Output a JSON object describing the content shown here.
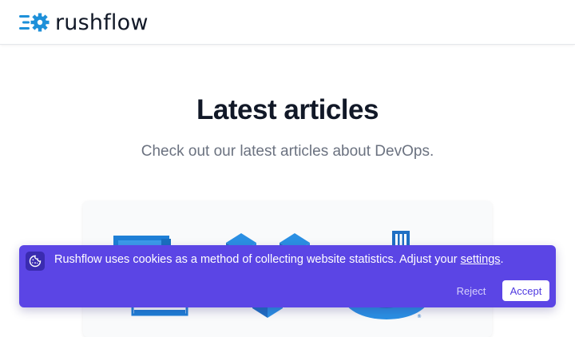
{
  "header": {
    "brand_name": "rushflow",
    "logo_icon": "gear-speed-icon"
  },
  "hero": {
    "title": "Latest articles",
    "subtitle": "Check out our latest articles about DevOps."
  },
  "article_card": {
    "illustration_icons": [
      "monitor-icon",
      "cube-icon",
      "sql-server-icon"
    ]
  },
  "cookie_banner": {
    "icon": "cookie-icon",
    "message": "Rushflow uses cookies as a method of collecting website statistics. Adjust your ",
    "link_label": "settings",
    "message_end": ".",
    "reject_label": "Reject",
    "accept_label": "Accept"
  },
  "colors": {
    "brand": "#1e90d9",
    "banner": "#5b45e5",
    "title": "#111827",
    "subtitle": "#6b7280"
  }
}
